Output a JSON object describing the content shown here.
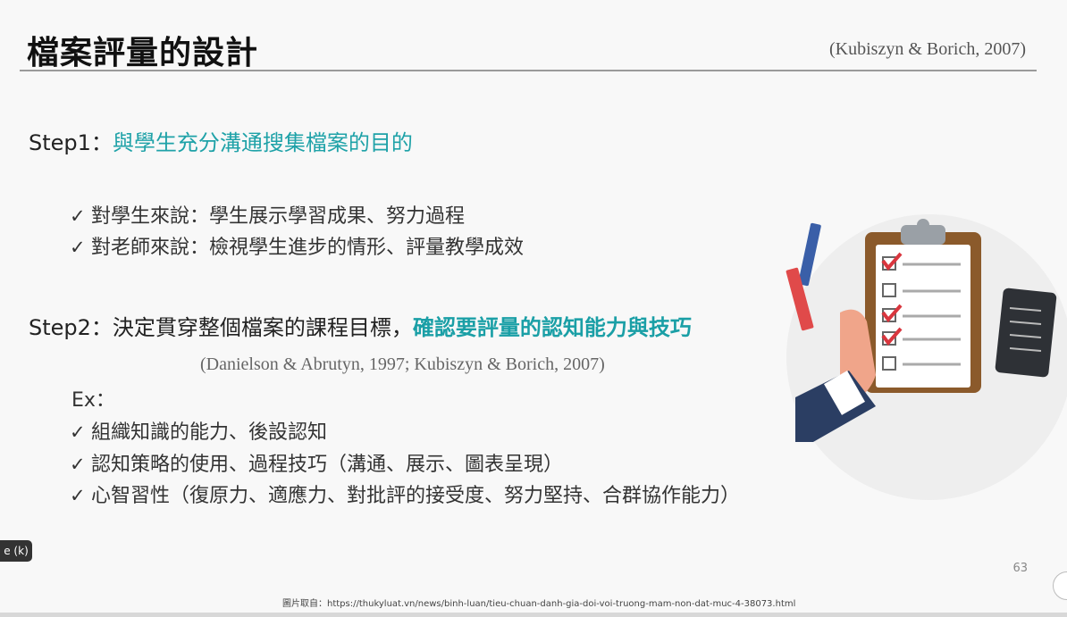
{
  "slide": {
    "title": "檔案評量的設計",
    "citation_top": "(Kubiszyn & Borich, 2007)",
    "step1": {
      "prefix": "Step1：",
      "highlight": "與學生充分溝通搜集檔案的目的"
    },
    "step1_items": [
      "對學生來說：學生展示學習成果、努力過程",
      "對老師來說：檢視學生進步的情形、評量教學成效"
    ],
    "step2": {
      "prefix": "Step2：決定貫穿整個檔案的課程目標，",
      "highlight": "確認要評量的認知能力與技巧"
    },
    "citation_mid": "(Danielson & Abrutyn, 1997; Kubiszyn & Borich, 2007)",
    "ex_label": "Ex：",
    "ex_items": [
      "組織知識的能力、後設認知",
      "認知策略的使用、過程技巧（溝通、展示、圖表呈現）",
      "心智習性（復原力、適應力、對批評的接受度、努力堅持、合群協作能力）"
    ],
    "check_glyph": "✓",
    "page_number": "63",
    "source": "圖片取自：https://thukyluat.vn/news/binh-luan/tieu-chuan-danh-gia-doi-voi-truong-mam-non-dat-muc-4-38073.html"
  },
  "overlay": {
    "shortcut_label": "e (k)"
  },
  "colors": {
    "accent": "#1fa2a8",
    "title_rule": "#9a9a9a",
    "clipboard": "#8b5a2b",
    "check_red": "#d9363e"
  },
  "illustration": {
    "icons": [
      "clipboard-icon",
      "pencil-icon",
      "checklist-icon",
      "hand-icon"
    ]
  }
}
